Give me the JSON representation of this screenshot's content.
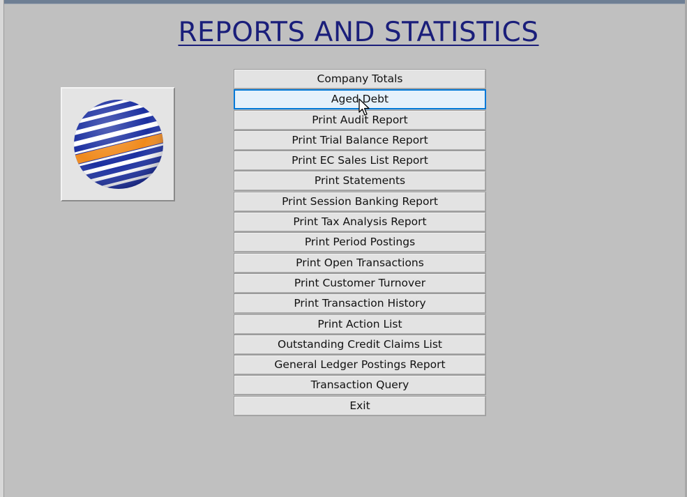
{
  "window": {
    "title": "REPORTS AND STATISTICS"
  },
  "logo": {
    "icon": "striped-globe-icon",
    "colors": {
      "blue": "#1b2fa0",
      "orange": "#f08a1c",
      "white": "#ffffff"
    }
  },
  "menu": {
    "items": [
      {
        "label": "Company Totals",
        "name": "company-totals-button"
      },
      {
        "label": "Aged Debt",
        "name": "aged-debt-button",
        "hovered": true
      },
      {
        "label": "Print Audit Report",
        "name": "print-audit-report-button"
      },
      {
        "label": "Print Trial Balance Report",
        "name": "print-trial-balance-report-button"
      },
      {
        "label": "Print EC Sales List Report",
        "name": "print-ec-sales-list-report-button"
      },
      {
        "label": "Print Statements",
        "name": "print-statements-button"
      },
      {
        "label": "Print Session Banking Report",
        "name": "print-session-banking-report-button"
      },
      {
        "label": "Print Tax Analysis Report",
        "name": "print-tax-analysis-report-button"
      },
      {
        "label": "Print Period Postings",
        "name": "print-period-postings-button"
      },
      {
        "label": "Print Open Transactions",
        "name": "print-open-transactions-button"
      },
      {
        "label": "Print Customer Turnover",
        "name": "print-customer-turnover-button"
      },
      {
        "label": "Print Transaction History",
        "name": "print-transaction-history-button"
      },
      {
        "label": "Print Action List",
        "name": "print-action-list-button"
      },
      {
        "label": "Outstanding Credit Claims List",
        "name": "outstanding-credit-claims-list-button"
      },
      {
        "label": "General Ledger Postings Report",
        "name": "general-ledger-postings-report-button"
      },
      {
        "label": "Transaction Query",
        "name": "transaction-query-button"
      },
      {
        "label": "Exit",
        "name": "exit-button"
      }
    ]
  },
  "colors": {
    "background": "#c0c0c0",
    "title": "#1a1e7a",
    "button_face": "#e3e3e3",
    "button_hover": "#e5f1fb",
    "hover_border": "#0078d7"
  }
}
